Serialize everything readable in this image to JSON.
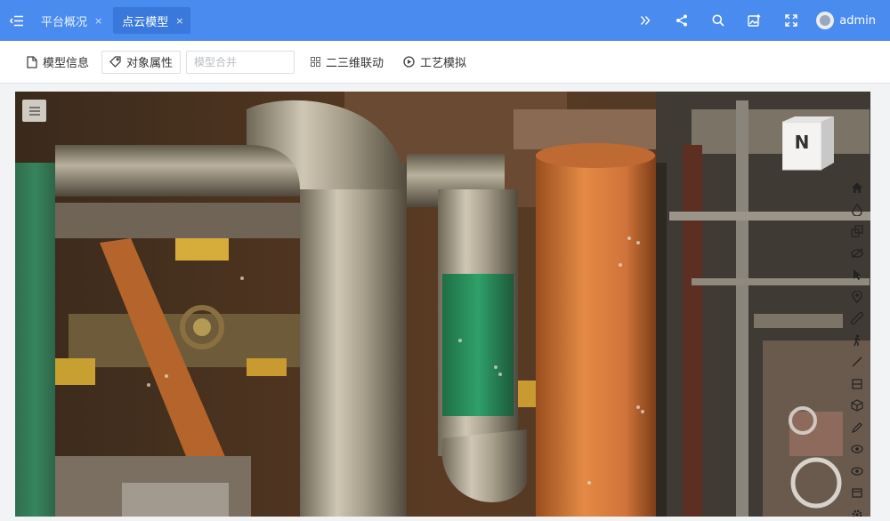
{
  "header": {
    "tabs": [
      {
        "label": "平台概况",
        "active": false
      },
      {
        "label": "点云模型",
        "active": true
      }
    ],
    "close_symbol": "×",
    "username": "admin",
    "icons": [
      "chevrons-right-icon",
      "share-icon",
      "search-icon",
      "image-export-icon",
      "fullscreen-icon"
    ]
  },
  "toolbar": {
    "model_info": "模型信息",
    "object_props": "对象属性",
    "merge_placeholder": "模型合并",
    "linkage_2d3d": "二三维联动",
    "process_sim": "工艺模拟"
  },
  "viewport": {
    "compass_label": "N",
    "tools": [
      "home-icon",
      "drop-icon",
      "layers-icon",
      "hide-icon",
      "select-arrow-icon",
      "location-pin-icon",
      "ruler-icon",
      "walk-person-icon",
      "slash-icon",
      "section-box-icon",
      "cube-icon",
      "pencil-icon",
      "eye-icon",
      "eye-icon",
      "clip-icon",
      "gear-icon"
    ]
  },
  "colors": {
    "header_bg": "#4a8bef",
    "active_tab_bg": "#3a78dc",
    "toolbar_bg": "#ffffff",
    "page_bg": "#f2f3f5"
  }
}
